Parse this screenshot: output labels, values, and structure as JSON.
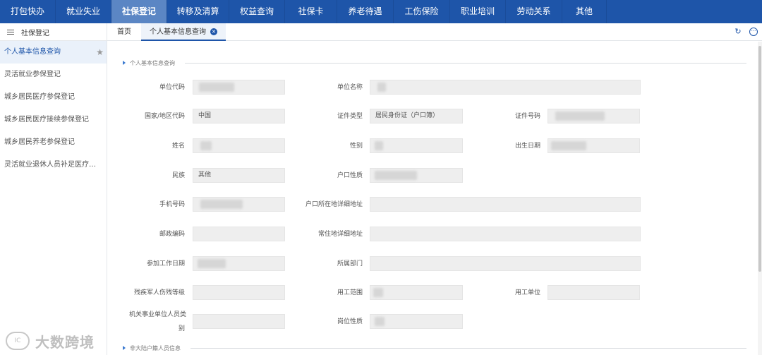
{
  "topnav": {
    "items": [
      "打包快办",
      "就业失业",
      "社保登记",
      "转移及清算",
      "权益查询",
      "社保卡",
      "养老待遇",
      "工伤保险",
      "职业培训",
      "劳动关系",
      "其他"
    ],
    "active_index": 2,
    "bg_color": "#1e55a9",
    "active_color": "#5b86c4"
  },
  "sidebar": {
    "header": "社保登记",
    "items": [
      "个人基本信息查询",
      "灵活就业参保登记",
      "城乡居民医疗参保登记",
      "城乡居民医疗接续参保登记",
      "城乡居民养老参保登记",
      "灵活就业退休人员补足医疗…"
    ],
    "active_index": 0
  },
  "tabs": {
    "home": "首页",
    "active": "个人基本信息查询",
    "close_icon": "×",
    "refresh_icon": "↻",
    "more_icon": "···"
  },
  "section1": {
    "title": "个人基本信息查询"
  },
  "section2": {
    "title": "非大陆户籍人员信息"
  },
  "form": {
    "unit_code": {
      "label": "单位代码",
      "value": ""
    },
    "unit_name": {
      "label": "单位名称",
      "value": ""
    },
    "country_code": {
      "label": "国家/地区代码",
      "value": "中国"
    },
    "id_type": {
      "label": "证件类型",
      "value": "居民身份证（户口簿）"
    },
    "id_number": {
      "label": "证件号码",
      "value": ""
    },
    "name": {
      "label": "姓名",
      "value": ""
    },
    "gender": {
      "label": "性别",
      "value": ""
    },
    "birth_date": {
      "label": "出生日期",
      "value": ""
    },
    "ethnicity": {
      "label": "民族",
      "value": "其他"
    },
    "hukou_type": {
      "label": "户口性质",
      "value": ""
    },
    "mobile": {
      "label": "手机号码",
      "value": ""
    },
    "hukou_address": {
      "label": "户口所在地详细地址",
      "value": ""
    },
    "postcode": {
      "label": "邮政编码",
      "value": ""
    },
    "residence_address": {
      "label": "常住地详细地址",
      "value": ""
    },
    "work_start_date": {
      "label": "参加工作日期",
      "value": ""
    },
    "department": {
      "label": "所属部门",
      "value": ""
    },
    "disability_level": {
      "label": "残疾军人伤残等级",
      "value": ""
    },
    "employment_scope": {
      "label": "用工范围",
      "value": ""
    },
    "employer": {
      "label": "用工单位",
      "value": ""
    },
    "institution_category": {
      "label_line1": "机关事业单位人员类",
      "label_line2": "别",
      "value": ""
    },
    "post_nature": {
      "label": "岗位性质",
      "value": ""
    }
  },
  "watermark": {
    "logo_text": "IC",
    "text": "大数跨境"
  }
}
